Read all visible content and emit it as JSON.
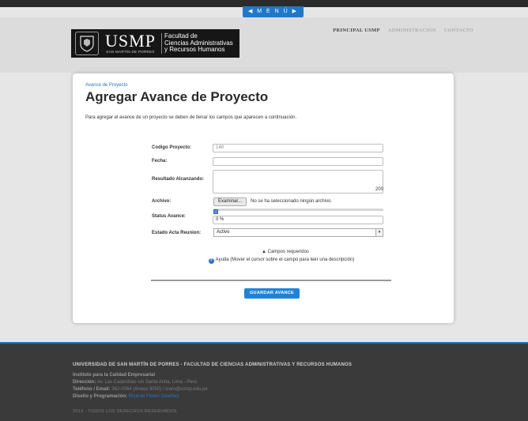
{
  "menu": {
    "label": "◀  M E N Ú  ▶"
  },
  "logo": {
    "usmp": "USMP",
    "subtitle": "SAN MARTÍN DE PORRES",
    "faculty_line1": "Facultad de",
    "faculty_line2": "Ciencias Administrativas",
    "faculty_line3": "y Recursos Humanos"
  },
  "topnav": {
    "items": [
      "PRINCIPAL USMP",
      "ADMINISTRACIÓN",
      "CONTACTO"
    ]
  },
  "page": {
    "breadcrumb": "Avance de Proyecto",
    "title": "Agregar Avance de Proyecto",
    "instructions": "Para agregar el avance de un proyecto se deben de llenar los campos que aparecen a continuación."
  },
  "form": {
    "codigo_label": "Codigo Proyecto:",
    "codigo_value": "148",
    "fecha_label": "Fecha:",
    "fecha_value": "",
    "resultado_label": "Resultado Alcanzando:",
    "resultado_value": "",
    "resultado_counter": "200",
    "archivo_label": "Archivo:",
    "archivo_button": "Examinar...",
    "archivo_status": "No se ha seleccionado ningún archivo.",
    "status_label": "Status Avance:",
    "status_value": "0 %",
    "status_fraction": 0,
    "estado_label": "Estado Acta Reunion:",
    "estado_value": "Activo"
  },
  "notes": {
    "required": "Campos requeridos",
    "help": "Ayuda (Mover el cursor sobre el campo para leer una descripción)"
  },
  "save_button": "GUARDAR AVANCE",
  "footer": {
    "title": "UNIVERSIDAD DE SAN MARTÍN DE PORRES - FACULTAD DE CIENCIAS ADMINISTRATIVAS Y RECURSOS HUMANOS",
    "institute": "Instituto para la Calidad Empresarial",
    "address_label": "Dirección:",
    "address_value": "Av. Las Calandrias s/n Santa Anita, Lima - Perú",
    "phone_label": "Teléfono / Email:",
    "phone_value": "362-0064 (Anexo 3050) / icem@usmp.edu.pe",
    "design_label": "Diseño y Programación:",
    "design_value": "Ricardo Flores Sánchez",
    "copyright": "2013 - TODOS LOS DERECHOS RESERVADOS"
  },
  "colors": {
    "accent": "#1e83d8",
    "footer_bg": "#3a3a3a",
    "header_bg": "#dcdcdc"
  }
}
